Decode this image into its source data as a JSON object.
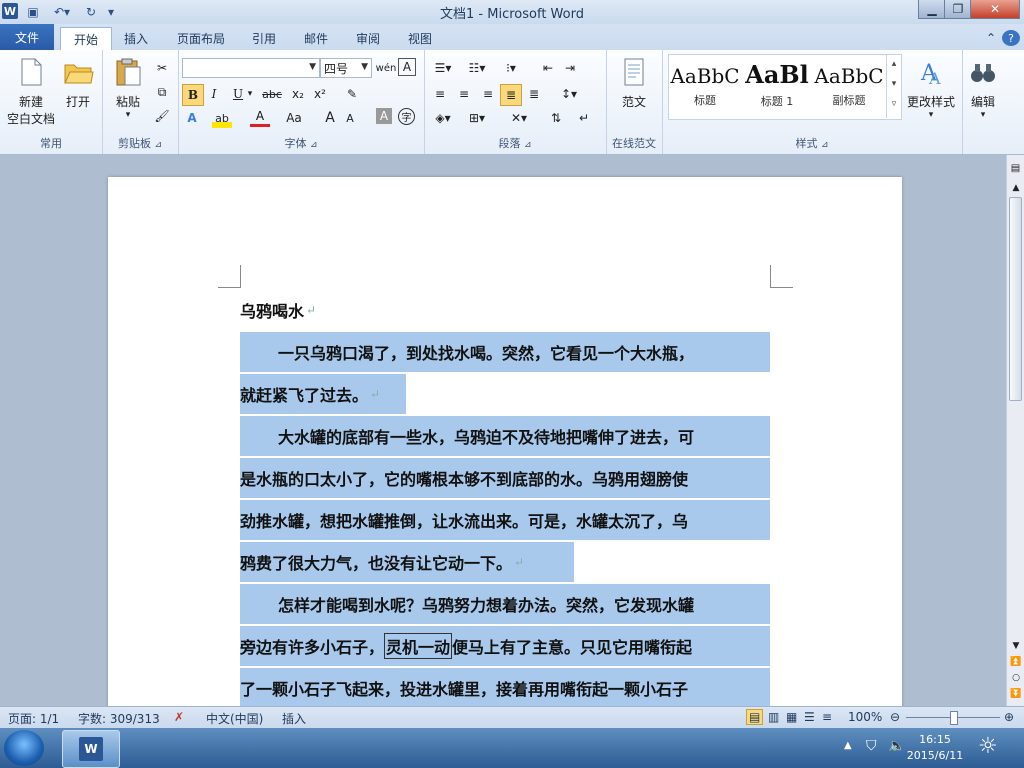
{
  "window": {
    "title": "文档1 - Microsoft Word",
    "logo": "W",
    "controls": [
      "minimize-icon",
      "restore-icon",
      "close-icon"
    ]
  },
  "tabs": [
    {
      "label": "文件"
    },
    {
      "label": "开始"
    },
    {
      "label": "插入"
    },
    {
      "label": "页面布局"
    },
    {
      "label": "引用"
    },
    {
      "label": "邮件"
    },
    {
      "label": "审阅"
    },
    {
      "label": "视图"
    }
  ],
  "ribbon": {
    "common": {
      "label": "常用",
      "new_line1": "新建",
      "new_line2": "空白文档",
      "open": "打开"
    },
    "clipboard": {
      "label": "剪贴板",
      "paste": "粘贴"
    },
    "font": {
      "label": "字体",
      "font_name": "",
      "font_size": "四号",
      "bold": "B",
      "italic": "I",
      "underline": "U",
      "strike": "abc",
      "subscript": "x₂",
      "superscript": "x²",
      "grow": "A",
      "shrink": "A",
      "aa": "Aa"
    },
    "paragraph": {
      "label": "段落"
    },
    "online": {
      "label": "在线范文",
      "sample": "范文"
    },
    "styles": {
      "label": "样式",
      "cards": [
        {
          "sample": "AaBbC",
          "name": "标题"
        },
        {
          "sample": "AaBl",
          "name": "标题 1"
        },
        {
          "sample": "AaBbC",
          "name": "副标题"
        }
      ],
      "change": "更改样式"
    },
    "edit": {
      "label": "编辑"
    }
  },
  "document": {
    "title": "乌鸦喝水",
    "lines": [
      "一只乌鸦口渴了，到处找水喝。突然，它看见一个大水瓶，",
      "就赶紧飞了过去。",
      "大水罐的底部有一些水，乌鸦迫不及待地把嘴伸了进去，可",
      "是水瓶的口太小了，它的嘴根本够不到底部的水。乌鸦用翅膀使",
      "劲推水罐，想把水罐推倒，让水流出来。可是，水罐太沉了，乌",
      "鸦费了很大力气，也没有让它动一下。",
      "怎样才能喝到水呢？乌鸦努力想着办法。突然，它发现水罐",
      "旁边有许多小石子，",
      "了一颗小石子飞起来，投进水罐里，接着再用嘴衔起一颗小石子"
    ],
    "line8_boxed": "灵机一动",
    "line8_rest": "便马上有了主意。只见它用嘴衔起"
  },
  "status": {
    "page": "页面: 1/1",
    "words": "字数: 309/313",
    "lang": "中文(中国)",
    "mode": "插入",
    "zoom": "100%"
  },
  "taskbar": {
    "time": "16:15",
    "date": "2015/6/11"
  }
}
